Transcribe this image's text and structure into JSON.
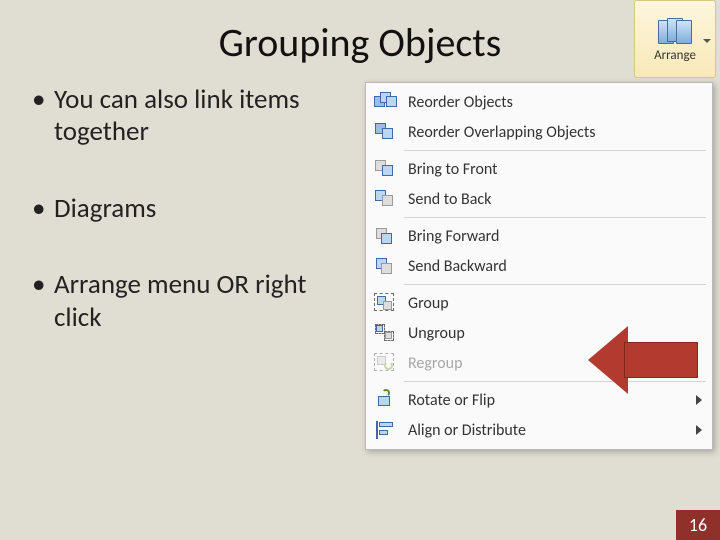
{
  "title": "Grouping Objects",
  "bullets": [
    "You can also link items together",
    "Diagrams",
    "Arrange menu OR right click"
  ],
  "arrange_button": {
    "label": "Arrange"
  },
  "menu": {
    "groups": [
      [
        {
          "label": "Reorder Objects",
          "icon": "reorder",
          "disabled": false,
          "submenu": false
        },
        {
          "label": "Reorder Overlapping Objects",
          "icon": "reorder-overlap",
          "disabled": false,
          "submenu": false
        }
      ],
      [
        {
          "label": "Bring to Front",
          "icon": "bring-front",
          "disabled": false,
          "submenu": false
        },
        {
          "label": "Send to Back",
          "icon": "send-back",
          "disabled": false,
          "submenu": false
        }
      ],
      [
        {
          "label": "Bring Forward",
          "icon": "bring-forward",
          "disabled": false,
          "submenu": false
        },
        {
          "label": "Send Backward",
          "icon": "send-backward",
          "disabled": false,
          "submenu": false
        }
      ],
      [
        {
          "label": "Group",
          "icon": "group",
          "disabled": false,
          "submenu": false
        },
        {
          "label": "Ungroup",
          "icon": "ungroup",
          "disabled": false,
          "submenu": false
        },
        {
          "label": "Regroup",
          "icon": "regroup",
          "disabled": true,
          "submenu": false
        }
      ],
      [
        {
          "label": "Rotate or Flip",
          "icon": "rotate",
          "disabled": false,
          "submenu": true
        },
        {
          "label": "Align or Distribute",
          "icon": "align",
          "disabled": false,
          "submenu": true
        }
      ]
    ]
  },
  "page_number": "16"
}
